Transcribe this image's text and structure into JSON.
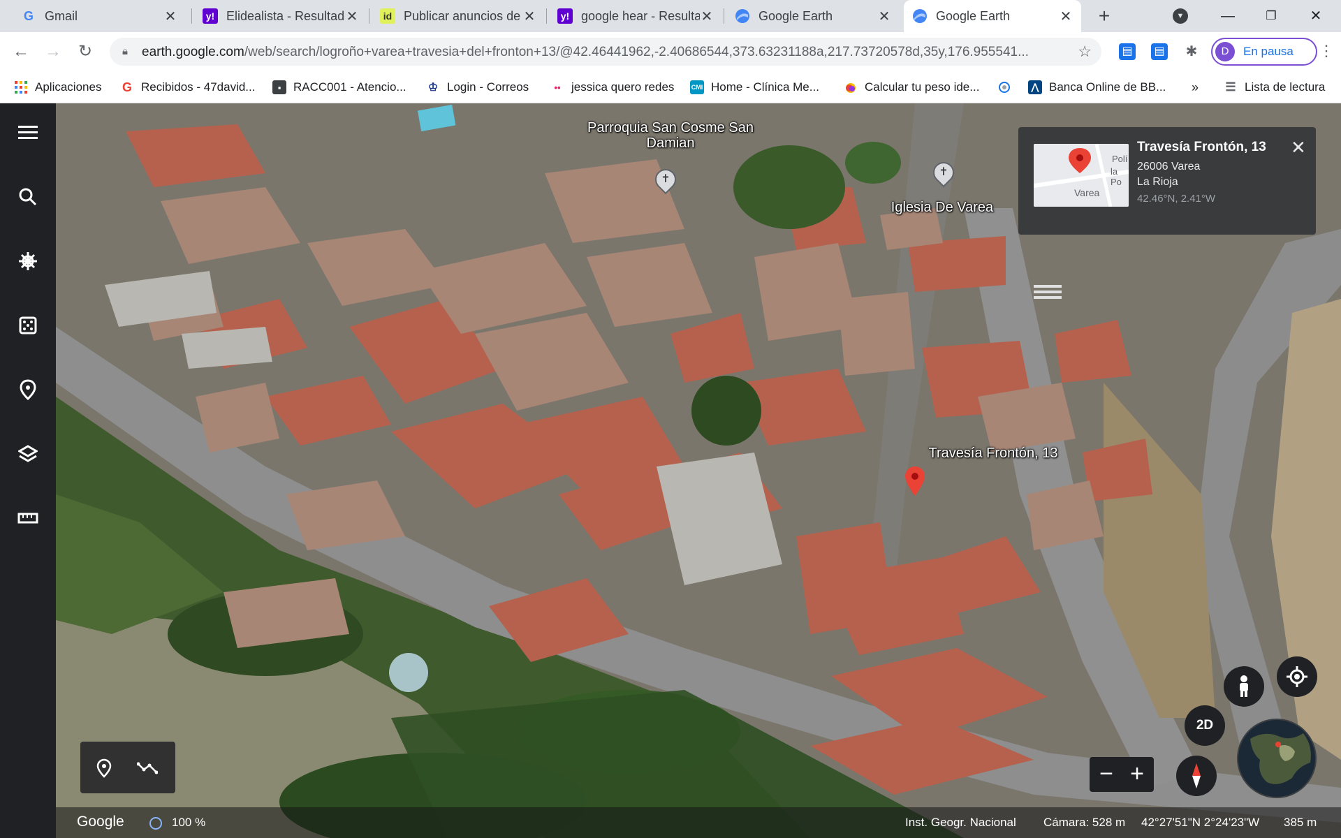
{
  "browser": {
    "tabs": [
      {
        "title": "Gmail",
        "favicon": "gmail-icon"
      },
      {
        "title": "Elidealista - Resultado",
        "favicon": "yahoo-icon"
      },
      {
        "title": "Publicar anuncios de",
        "favicon": "idealista-icon"
      },
      {
        "title": "google hear - Resulta",
        "favicon": "yahoo-icon"
      },
      {
        "title": "Google Earth",
        "favicon": "google-earth-icon"
      },
      {
        "title": "Google Earth",
        "favicon": "google-earth-icon",
        "active": true
      }
    ],
    "url_host": "earth.google.com",
    "url_path": "/web/search/logroño+varea+travesia+del+fronton+13/@42.46441962,-2.40686544,373.63231188a,217.73720578d,35y,176.955541...",
    "profile_initial": "D",
    "profile_label": "En pausa",
    "bookmarks": [
      {
        "label": "Aplicaciones",
        "icon": "apps-grid-icon"
      },
      {
        "label": "Recibidos - 47david...",
        "icon": "google-g-icon"
      },
      {
        "label": "RACC001 - Atencio...",
        "icon": "contact-card-icon"
      },
      {
        "label": "Login - Correos",
        "icon": "correos-icon"
      },
      {
        "label": "jessica quero redes",
        "icon": "dots-icon"
      },
      {
        "label": "Home - Clínica Me...",
        "icon": "cmi-icon"
      },
      {
        "label": "Calcular tu peso ide...",
        "icon": "apple-icon"
      },
      {
        "label": "",
        "icon": "loading-icon"
      },
      {
        "label": "Banca Online de BB...",
        "icon": "bbva-icon"
      }
    ],
    "more_bookmarks": "»",
    "reading_list": "Lista de lectura"
  },
  "map": {
    "labels": {
      "church1": "Parroquia San Cosme San Damian",
      "church2": "Iglesia De Varea",
      "address": "Travesía Frontón, 13"
    },
    "infocard": {
      "title": "Travesía Frontón, 13",
      "line1": "26006 Varea",
      "line2": "La Rioja",
      "coords": "42.46°N, 2.41°W",
      "thumb_label_1": "Varea",
      "thumb_label_2": "Polí",
      "thumb_label_3": "la Po"
    },
    "view_mode_button": "2D",
    "status": {
      "brand": "Google",
      "loading": "100 %",
      "attribution": "Inst. Geogr. Nacional",
      "camera": "Cámara: 528 m",
      "coordinates": "42°27'51\"N 2°24'23\"W",
      "scale": "385 m"
    }
  },
  "colors": {
    "accent": "#1a73e8",
    "profile": "#7b4fd4",
    "marker": "#ea4335",
    "sidebar": "#202124"
  }
}
